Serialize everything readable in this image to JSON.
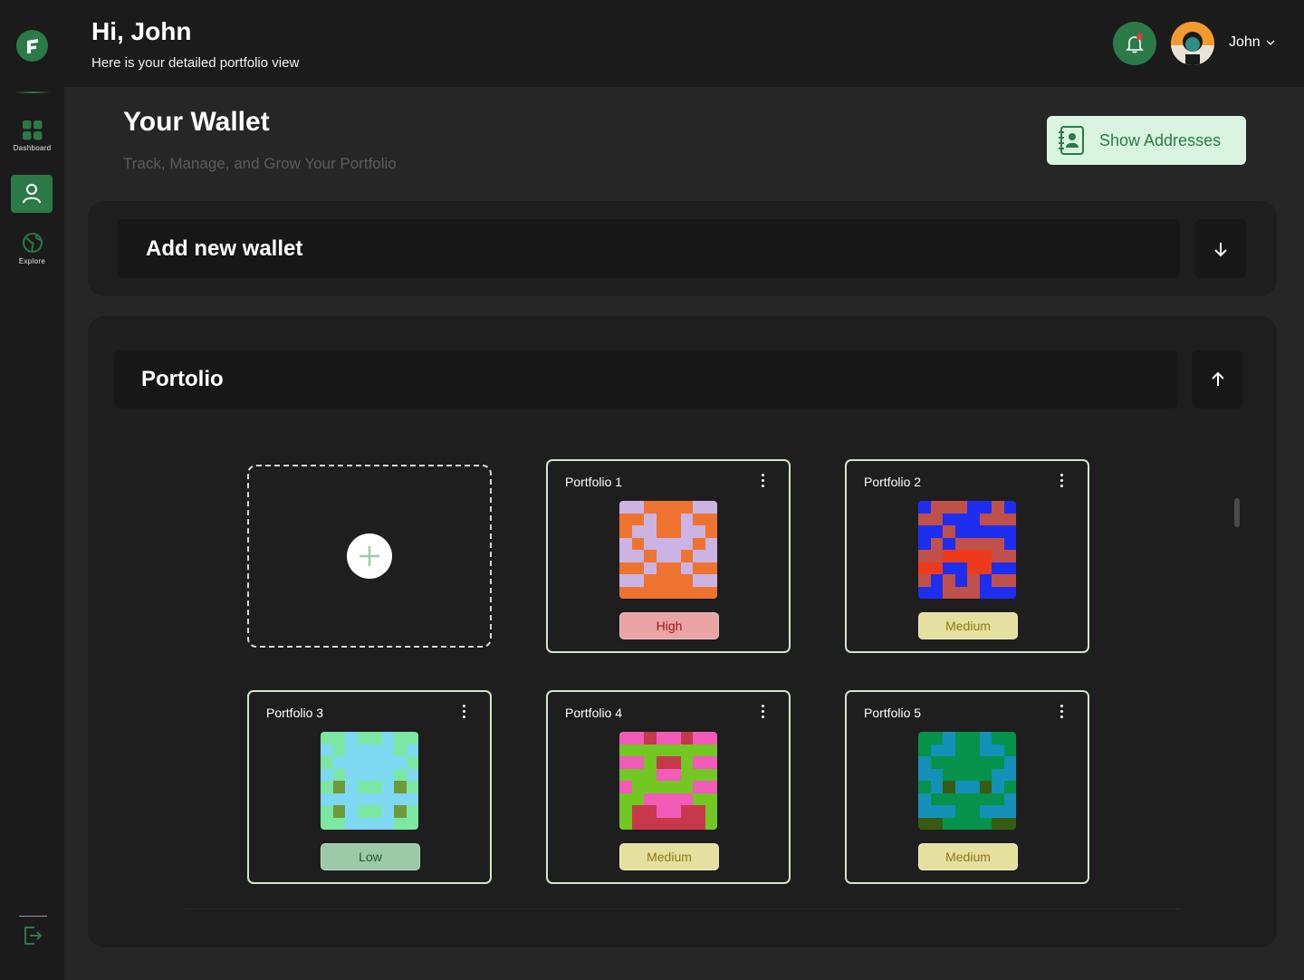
{
  "sidebar": {
    "items": [
      {
        "label": "Dashboard",
        "icon": "grid-icon"
      },
      {
        "label": "",
        "icon": "user-icon",
        "active": true
      },
      {
        "label": "Explore",
        "icon": "globe-icon"
      }
    ],
    "logout_icon": "logout-icon"
  },
  "header": {
    "greeting": "Hi, John",
    "subtitle": "Here is your detailed portfolio view",
    "user_name": "John",
    "notification_icon": "bell-icon"
  },
  "page": {
    "title": "Your Wallet",
    "subtitle": "Track, Manage, and Grow Your Portfolio",
    "show_addresses_label": "Show Addresses"
  },
  "add_wallet": {
    "label": "Add new wallet"
  },
  "portfolio_section": {
    "label": "Portolio"
  },
  "colors": {
    "accent": "#2b7a47",
    "high_bg": "#e9a4a4",
    "high_fg": "#a01616",
    "medium_bg": "#e5e0a0",
    "medium_fg": "#8a7a10",
    "low_bg": "#9cc9a7",
    "low_fg": "#1d5c33"
  },
  "portfolios": [
    {
      "name": "Portfolio 1",
      "risk": "High",
      "palette": [
        "#cbb3e3",
        "#ef7330"
      ]
    },
    {
      "name": "Portfolio 2",
      "risk": "Medium",
      "palette": [
        "#1d2ef0",
        "#c0504a",
        "#ee3a1b"
      ]
    },
    {
      "name": "Portfolio 3",
      "risk": "Low",
      "palette": [
        "#7be7a2",
        "#7fd8f2",
        "#6e9a3a"
      ]
    },
    {
      "name": "Portfolio 4",
      "risk": "Medium",
      "palette": [
        "#f25bb8",
        "#72c722",
        "#c7394a"
      ]
    },
    {
      "name": "Portfolio 5",
      "risk": "Medium",
      "palette": [
        "#06924a",
        "#1391b8",
        "#355c12"
      ]
    }
  ]
}
